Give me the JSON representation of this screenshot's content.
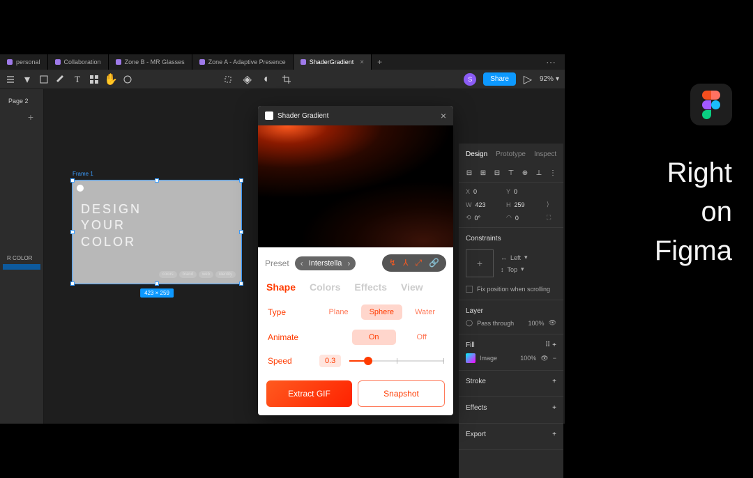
{
  "tabs": [
    {
      "label": "personal",
      "color": "#9f7aea"
    },
    {
      "label": "Collaboration",
      "color": "#9f7aea"
    },
    {
      "label": "Zone B - MR Glasses",
      "color": "#9f7aea"
    },
    {
      "label": "Zone A - Adaptive Presence",
      "color": "#9f7aea"
    },
    {
      "label": "ShaderGradient",
      "color": "#9f7aea",
      "active": true
    }
  ],
  "toolbar": {
    "avatar": "S",
    "share": "Share",
    "zoom": "92%"
  },
  "left_panel": {
    "page": "Page 2",
    "layers": [
      {
        "label": "R COLOR",
        "selected": false
      },
      {
        "label": "",
        "selected": true
      }
    ]
  },
  "frame": {
    "label": "Frame 1",
    "line1": "DESIGN",
    "line2": "YOUR",
    "line3": "COLOR",
    "chips": [
      "colors",
      "brand",
      "web",
      "identity"
    ],
    "dimensions": "423 × 259"
  },
  "plugin": {
    "title": "Shader Gradient",
    "preset_label": "Preset",
    "preset_name": "Interstella",
    "tabs": [
      "Shape",
      "Colors",
      "Effects",
      "View"
    ],
    "active_tab": "Shape",
    "type": {
      "label": "Type",
      "options": [
        "Plane",
        "Sphere",
        "Water"
      ],
      "selected": "Sphere"
    },
    "animate": {
      "label": "Animate",
      "options": [
        "On",
        "Off"
      ],
      "selected": "On"
    },
    "speed": {
      "label": "Speed",
      "value": "0.3"
    },
    "btn_primary": "Extract GIF",
    "btn_secondary": "Snapshot"
  },
  "inspector": {
    "tabs": [
      "Design",
      "Prototype",
      "Inspect"
    ],
    "x": "0",
    "y": "0",
    "w": "423",
    "h": "259",
    "rotation": "0°",
    "radius": "0",
    "constraints_label": "Constraints",
    "constraint_h": "Left",
    "constraint_v": "Top",
    "fix_scroll": "Fix position when scrolling",
    "layer_label": "Layer",
    "blend": "Pass through",
    "opacity": "100%",
    "fill_label": "Fill",
    "fill_type": "Image",
    "fill_opacity": "100%",
    "stroke_label": "Stroke",
    "effects_label": "Effects",
    "export_label": "Export"
  },
  "hero": {
    "line1": "Right",
    "line2": "on",
    "line3": "Figma"
  }
}
